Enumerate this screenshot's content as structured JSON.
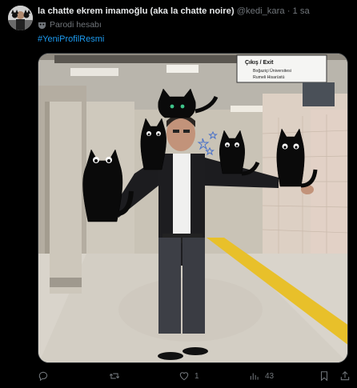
{
  "tweet": {
    "author_name": "la chatte ekrem imamoğlu (aka la chatte noire)",
    "handle": "@kedi_kara",
    "separator": "·",
    "time": "1 sa",
    "parody_icon": "mask-icon",
    "parody_label": "Parodi hesabı",
    "hashtag": "#YeniProfilResmi"
  },
  "media": {
    "sign_exit": "Çıkış / Exit",
    "sign_line1": "Boğaziçi Üniversitesi",
    "sign_line2": "Rumeli Hisarüstü"
  },
  "actions": {
    "reply_icon": "reply-icon",
    "retweet_icon": "retweet-icon",
    "like_icon": "heart-icon",
    "like_count": "1",
    "views_icon": "views-bar-chart-icon",
    "views_count": "43",
    "bookmark_icon": "bookmark-icon",
    "share_icon": "share-icon"
  },
  "colors": {
    "background": "#000000",
    "text_primary": "#e7e9ea",
    "text_secondary": "#71767b",
    "link": "#1d9bf0"
  }
}
